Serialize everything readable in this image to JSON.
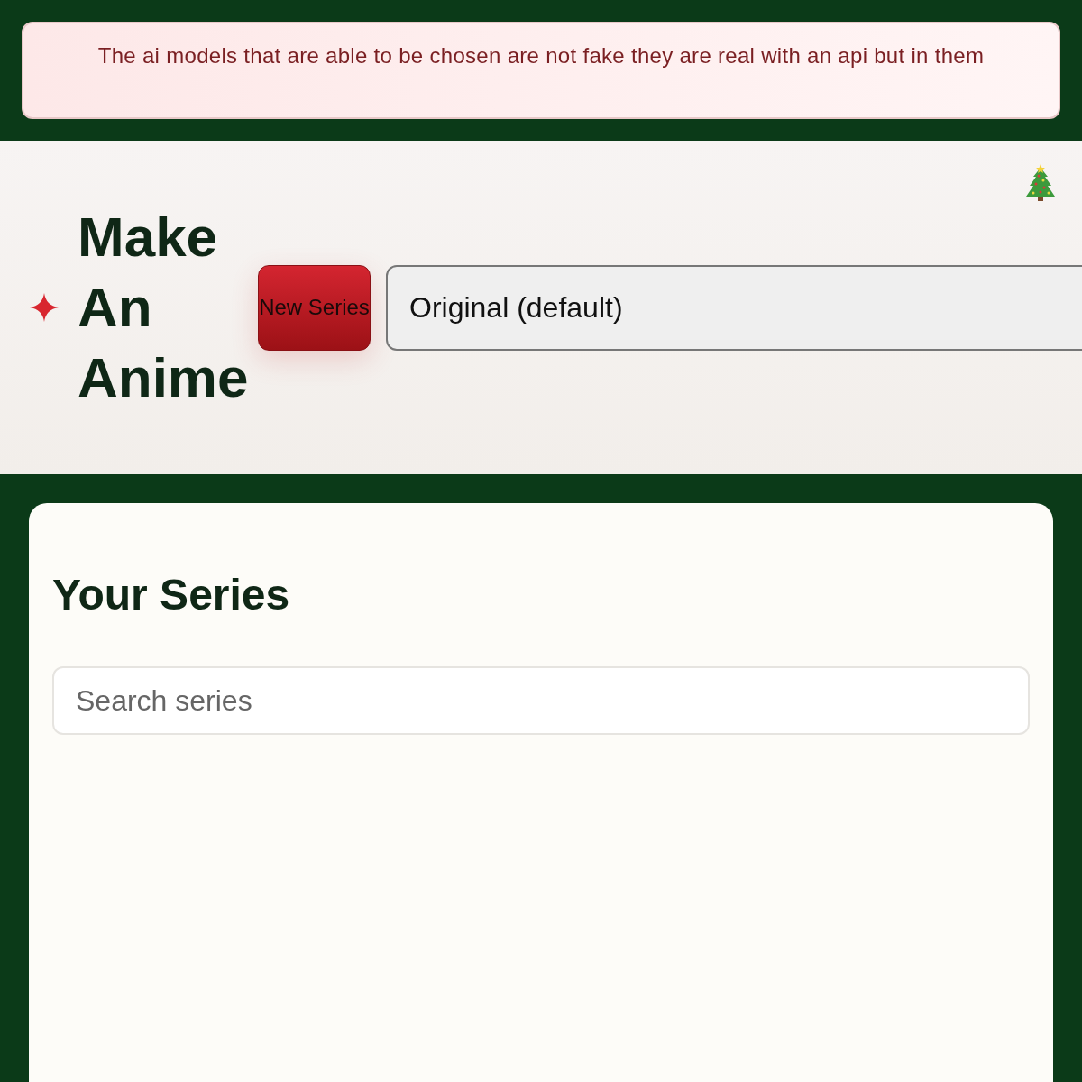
{
  "notice": "The ai models that are able to be chosen are not fake they are real with an api but in them",
  "header": {
    "title": "Make An Anime",
    "new_button": "New Series",
    "style_select": {
      "value": "Original (default)"
    }
  },
  "series_panel": {
    "heading": "Your Series",
    "search": {
      "placeholder": "Search series"
    }
  }
}
